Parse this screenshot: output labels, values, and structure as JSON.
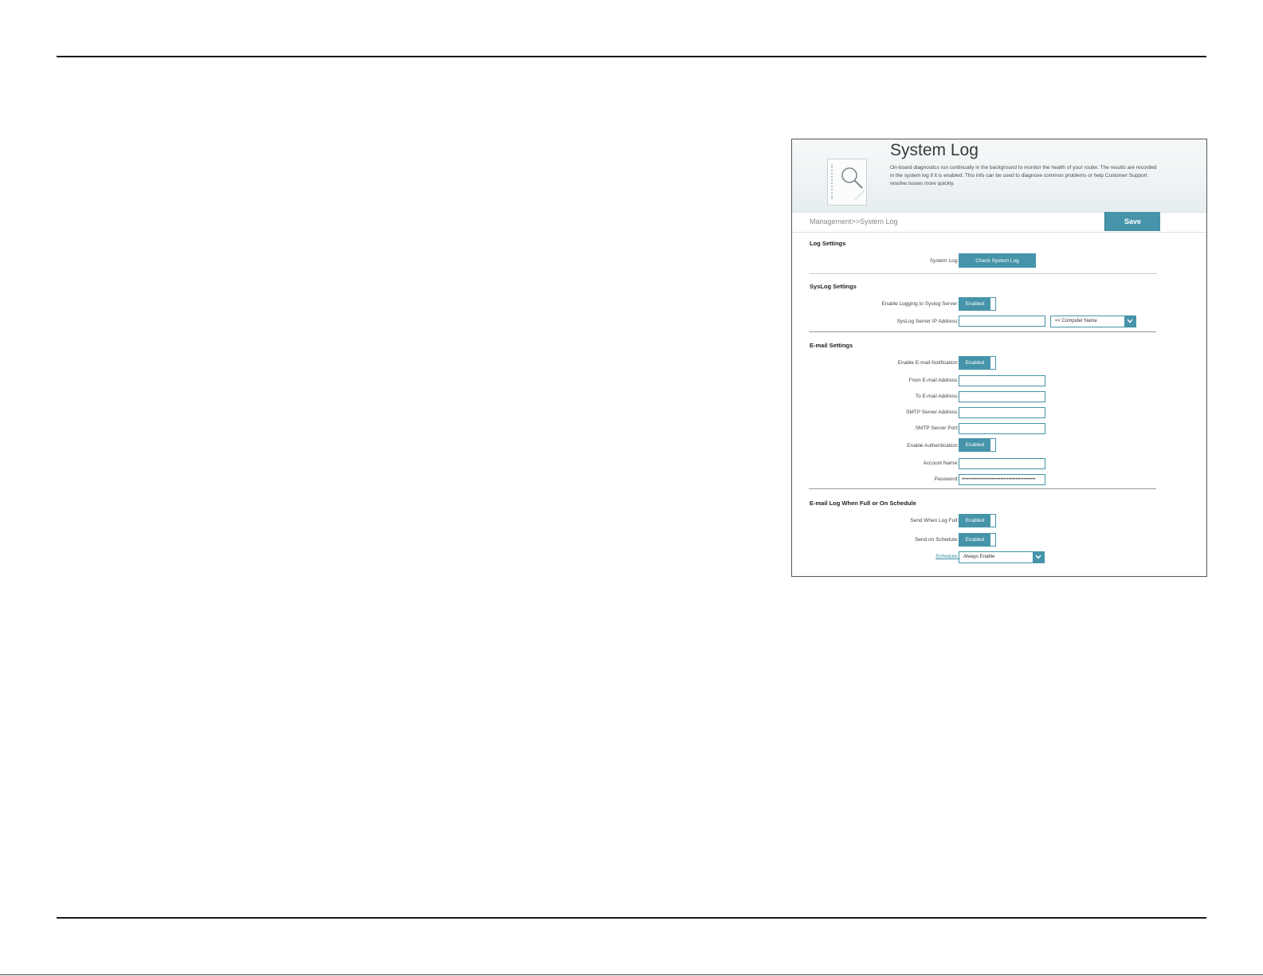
{
  "header": {
    "title": "System Log",
    "description": "On-board diagnostics run continually in the background to monitor the health of your router. The results are recorded in the system log if it is enabled. This info can be used to diagnose common problems or help Customer Support resolve issues more quickly."
  },
  "breadcrumb": "Management>>System Log",
  "save_label": "Save",
  "log_settings": {
    "title": "Log Settings",
    "system_log_label": "System Log:",
    "check_button": "Check System Log"
  },
  "syslog_settings": {
    "title": "SysLog Settings",
    "enable_label": "Enable Logging to Syslog Server:",
    "enable_value": "Enabled",
    "ip_label": "SysLog Server IP Address:",
    "ip_value": "",
    "computer_select": "<< Computer Name"
  },
  "email_settings": {
    "title": "E-mail Settings",
    "enable_label": "Enable E-mail Notification:",
    "enable_value": "Enabled",
    "from_label": "From E-mail Address:",
    "from_value": "",
    "to_label": "To E-mail Address:",
    "to_value": "",
    "smtp_addr_label": "SMTP Server Address:",
    "smtp_addr_value": "",
    "smtp_port_label": "SMTP Server Port:",
    "smtp_port_value": "",
    "auth_label": "Enable Authentication:",
    "auth_value": "Enabled",
    "account_label": "Account Name:",
    "account_value": "",
    "password_label": "Password:",
    "password_value": "••••••••••••••••••••••••••••••••••••••••••••"
  },
  "email_log": {
    "title": "E-mail Log When Full or On Schedule",
    "full_label": "Send When Log Full:",
    "full_value": "Enabled",
    "schedule_label": "Send on Schedule:",
    "schedule_value": "Enabled",
    "schedule_link": "Schedule:",
    "schedule_select": "Always Enable"
  },
  "colors": {
    "accent": "#4594a9",
    "header_bg": "#e7eef0"
  },
  "icons": {
    "header_icon": "document-search-icon",
    "dropdown_icon": "chevron-down-icon"
  }
}
